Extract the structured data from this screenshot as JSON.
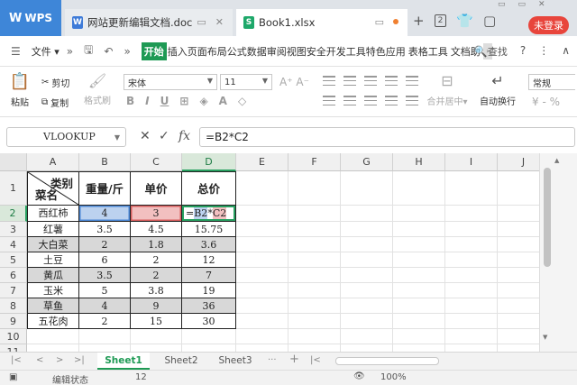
{
  "titlebar": {
    "app_tab": "WPS",
    "tabs": [
      {
        "label": "网站更新编辑文档.doc"
      },
      {
        "label": "Book1.xlsx"
      }
    ],
    "tab_count": "2",
    "login_label": "未登录"
  },
  "menubar": {
    "file_label": "文件",
    "items": [
      "开始",
      "插入",
      "页面布局",
      "公式",
      "数据",
      "审阅",
      "视图",
      "安全",
      "开发工具",
      "特色应用",
      "表格工具",
      "文档助"
    ],
    "search_label": "查找"
  },
  "ribbon": {
    "paste_label": "粘贴",
    "cut_label": "剪切",
    "copy_label": "复制",
    "format_painter_label": "格式刷",
    "font_name": "宋体",
    "font_size": "11",
    "merge_label": "合并居中",
    "wrap_label": "自动换行",
    "number_format": "常规"
  },
  "formula_bar": {
    "name_box": "VLOOKUP",
    "formula": "=B2*C2"
  },
  "grid": {
    "columns": [
      "A",
      "B",
      "C",
      "D",
      "E",
      "F",
      "G",
      "H",
      "I",
      "J"
    ],
    "rows": [
      "1",
      "2",
      "3",
      "4",
      "5",
      "6",
      "7",
      "8",
      "9",
      "10",
      "11"
    ],
    "header_top_right": "类别",
    "header_bottom_left": "菜名",
    "headers": [
      "重量/斤",
      "单价",
      "总价"
    ],
    "data": [
      [
        "西红柿",
        "4",
        "3",
        "=B2*C2"
      ],
      [
        "红薯",
        "3.5",
        "4.5",
        "15.75"
      ],
      [
        "大白菜",
        "2",
        "1.8",
        "3.6"
      ],
      [
        "土豆",
        "6",
        "2",
        "12"
      ],
      [
        "黄瓜",
        "3.5",
        "2",
        "7"
      ],
      [
        "玉米",
        "5",
        "3.8",
        "19"
      ],
      [
        "草鱼",
        "4",
        "9",
        "36"
      ],
      [
        "五花肉",
        "2",
        "15",
        "30"
      ]
    ],
    "active_formula_parts": [
      "=",
      "B2",
      "*",
      "C2"
    ]
  },
  "sheets": [
    "Sheet1",
    "Sheet2",
    "Sheet3"
  ],
  "statusbar": {
    "mode": "编辑状态",
    "value": "12",
    "zoom": "100%"
  }
}
